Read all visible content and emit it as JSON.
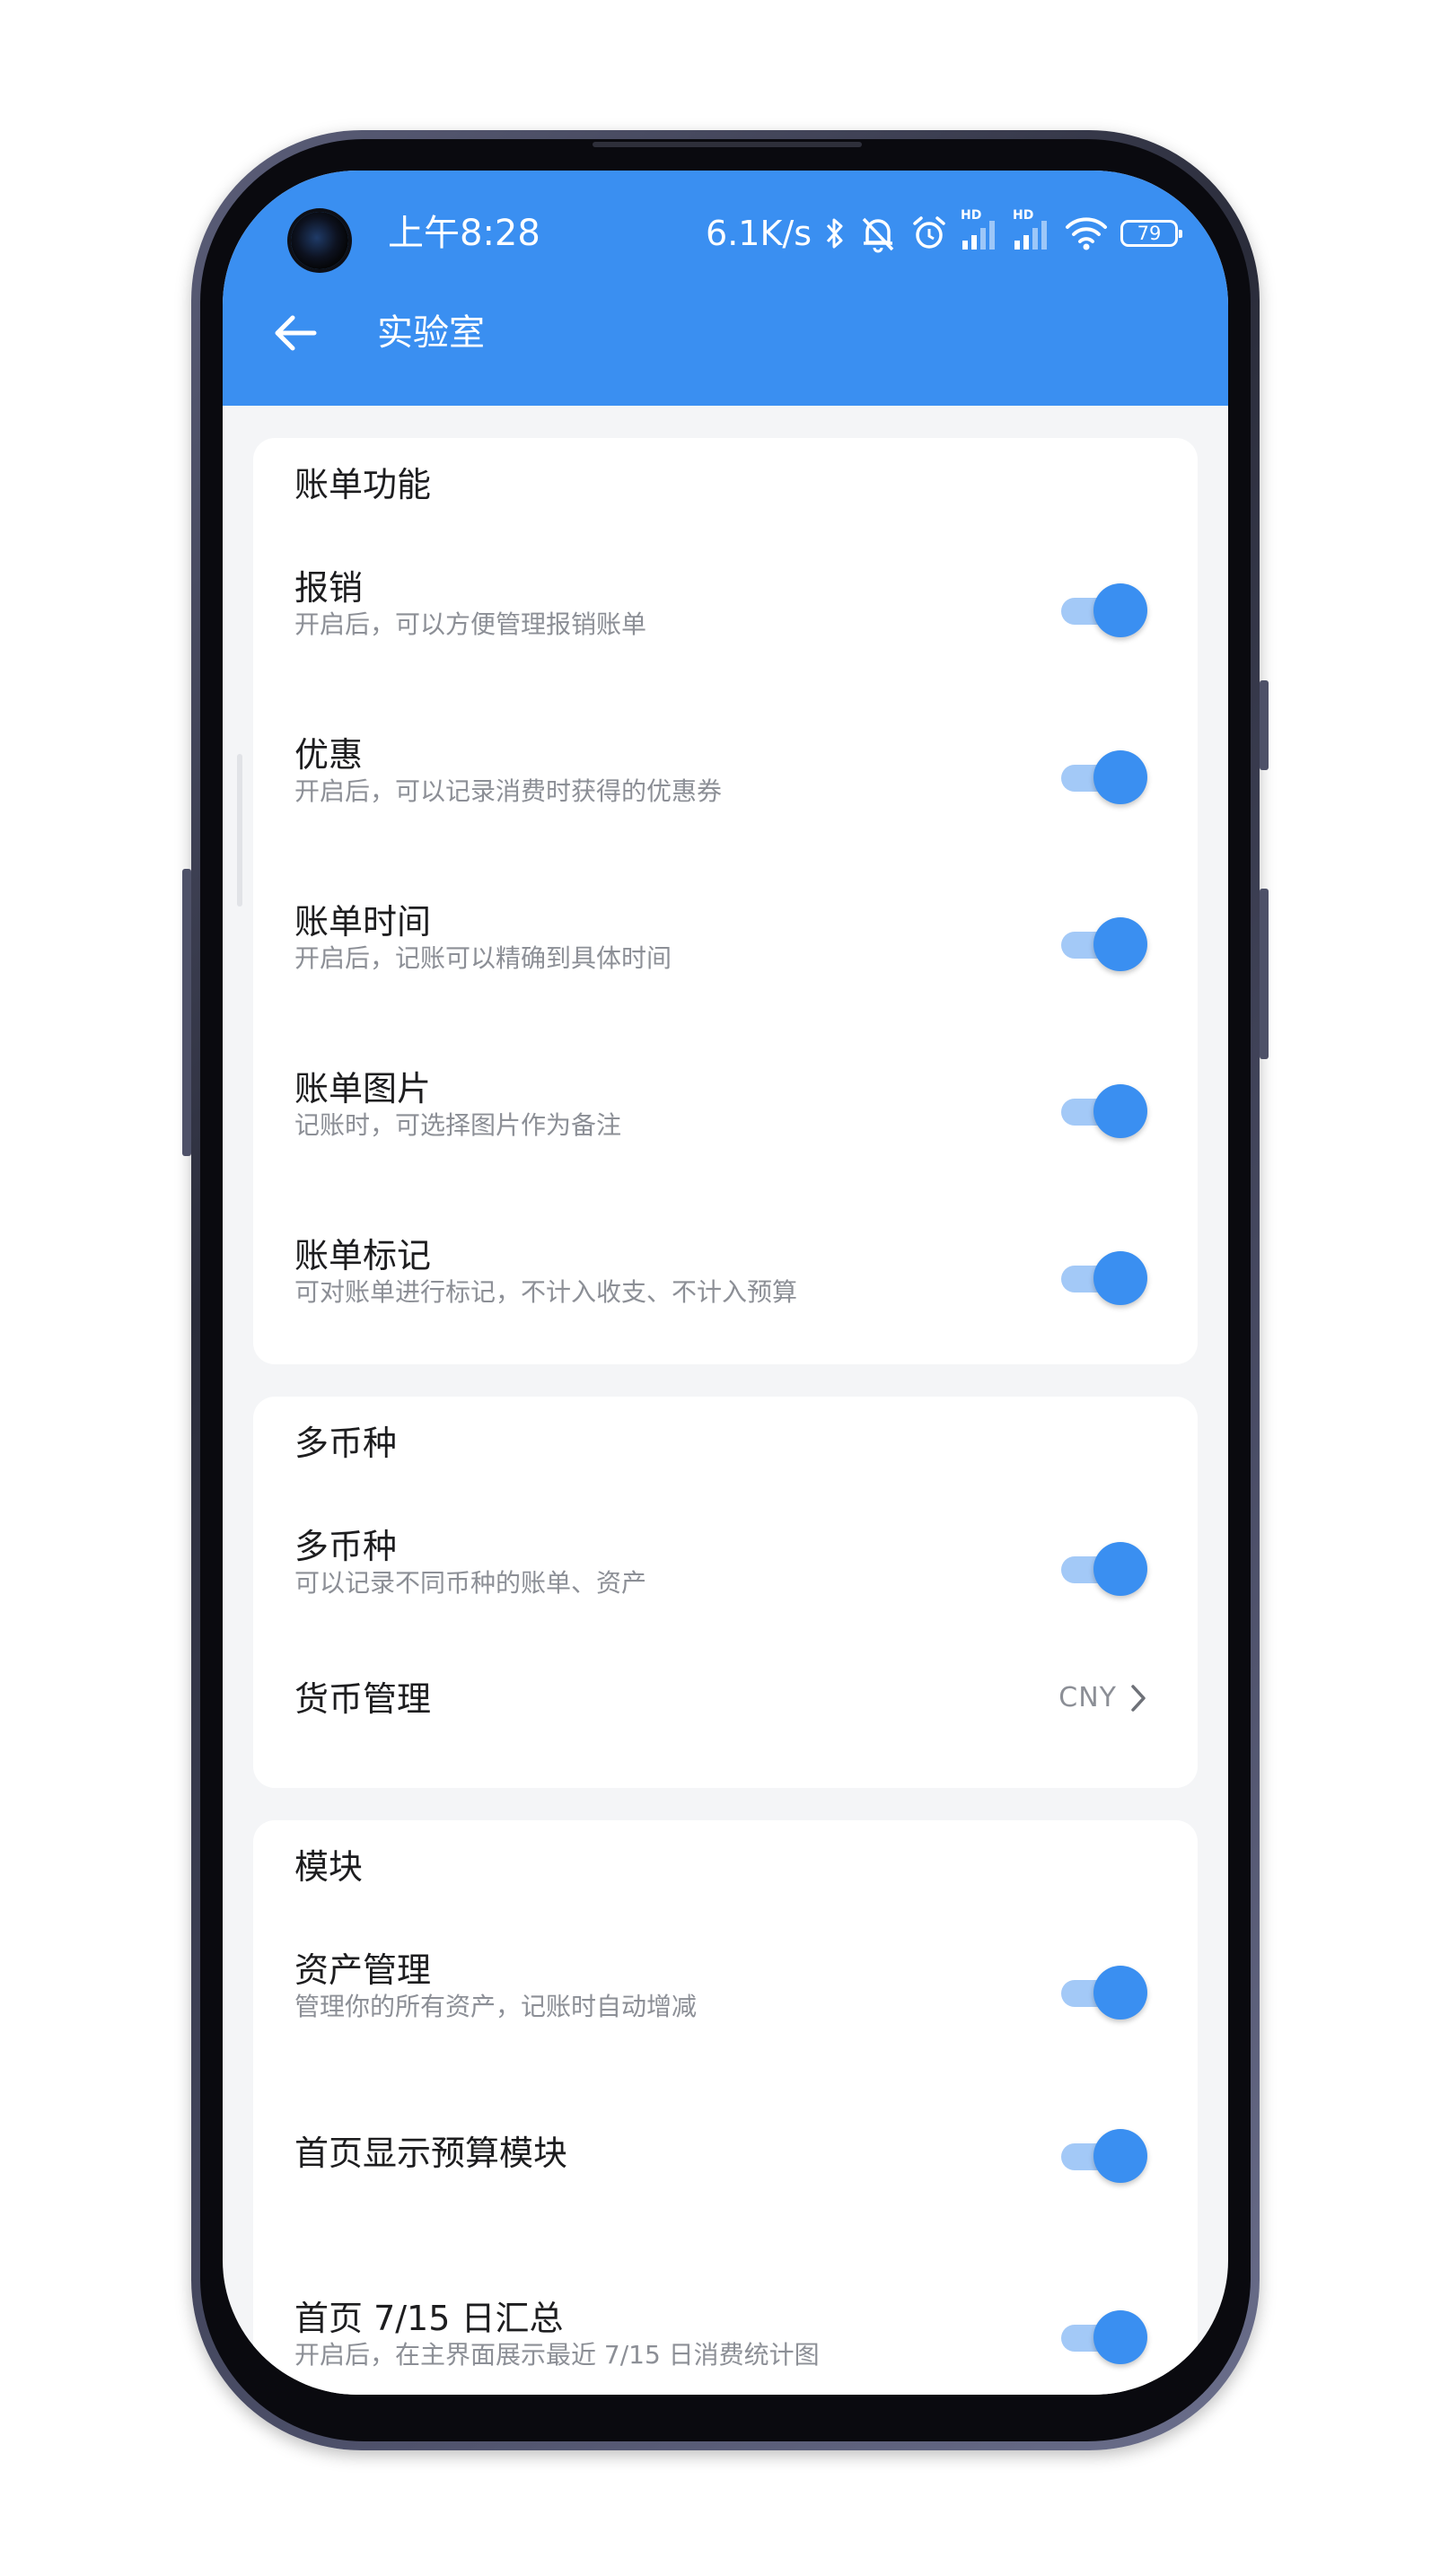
{
  "status_bar": {
    "time": "上午8:28",
    "net_speed": "6.1K/s",
    "signal_1_label": "HD",
    "signal_2_label": "HD",
    "battery": "79",
    "icons": [
      "bluetooth-icon",
      "mute-icon",
      "alarm-icon",
      "signal-icon",
      "signal-icon",
      "wifi-icon",
      "battery-icon"
    ]
  },
  "header": {
    "title": "实验室",
    "back_icon": "arrow-left-icon",
    "background_color": "#3a8ff1"
  },
  "colors": {
    "accent": "#3a8ff1",
    "toggle_track": "#a3c9f7",
    "secondary_text": "#8c8f96",
    "page_background": "#f4f5f7"
  },
  "sections": [
    {
      "title": "账单功能",
      "items": [
        {
          "title": "报销",
          "desc": "开启后，可以方便管理报销账单",
          "enabled": true
        },
        {
          "title": "优惠",
          "desc": "开启后，可以记录消费时获得的优惠券",
          "enabled": true
        },
        {
          "title": "账单时间",
          "desc": "开启后，记账可以精确到具体时间",
          "enabled": true
        },
        {
          "title": "账单图片",
          "desc": "记账时，可选择图片作为备注",
          "enabled": true
        },
        {
          "title": "账单标记",
          "desc": "可对账单进行标记，不计入收支、不计入预算",
          "enabled": true
        }
      ]
    },
    {
      "title": "多币种",
      "items": [
        {
          "title": "多币种",
          "desc": "可以记录不同币种的账单、资产",
          "enabled": true
        },
        {
          "title": "货币管理",
          "value": "CNY",
          "icon": "chevron-right-icon"
        }
      ]
    },
    {
      "title": "模块",
      "items": [
        {
          "title": "资产管理",
          "desc": "管理你的所有资产，记账时自动增减",
          "enabled": true
        },
        {
          "title": "首页显示预算模块",
          "enabled": true
        },
        {
          "title": "首页 7/15 日汇总",
          "desc": "开启后，在主界面展示最近 7/15 日消费统计图",
          "enabled": true
        }
      ]
    }
  ]
}
